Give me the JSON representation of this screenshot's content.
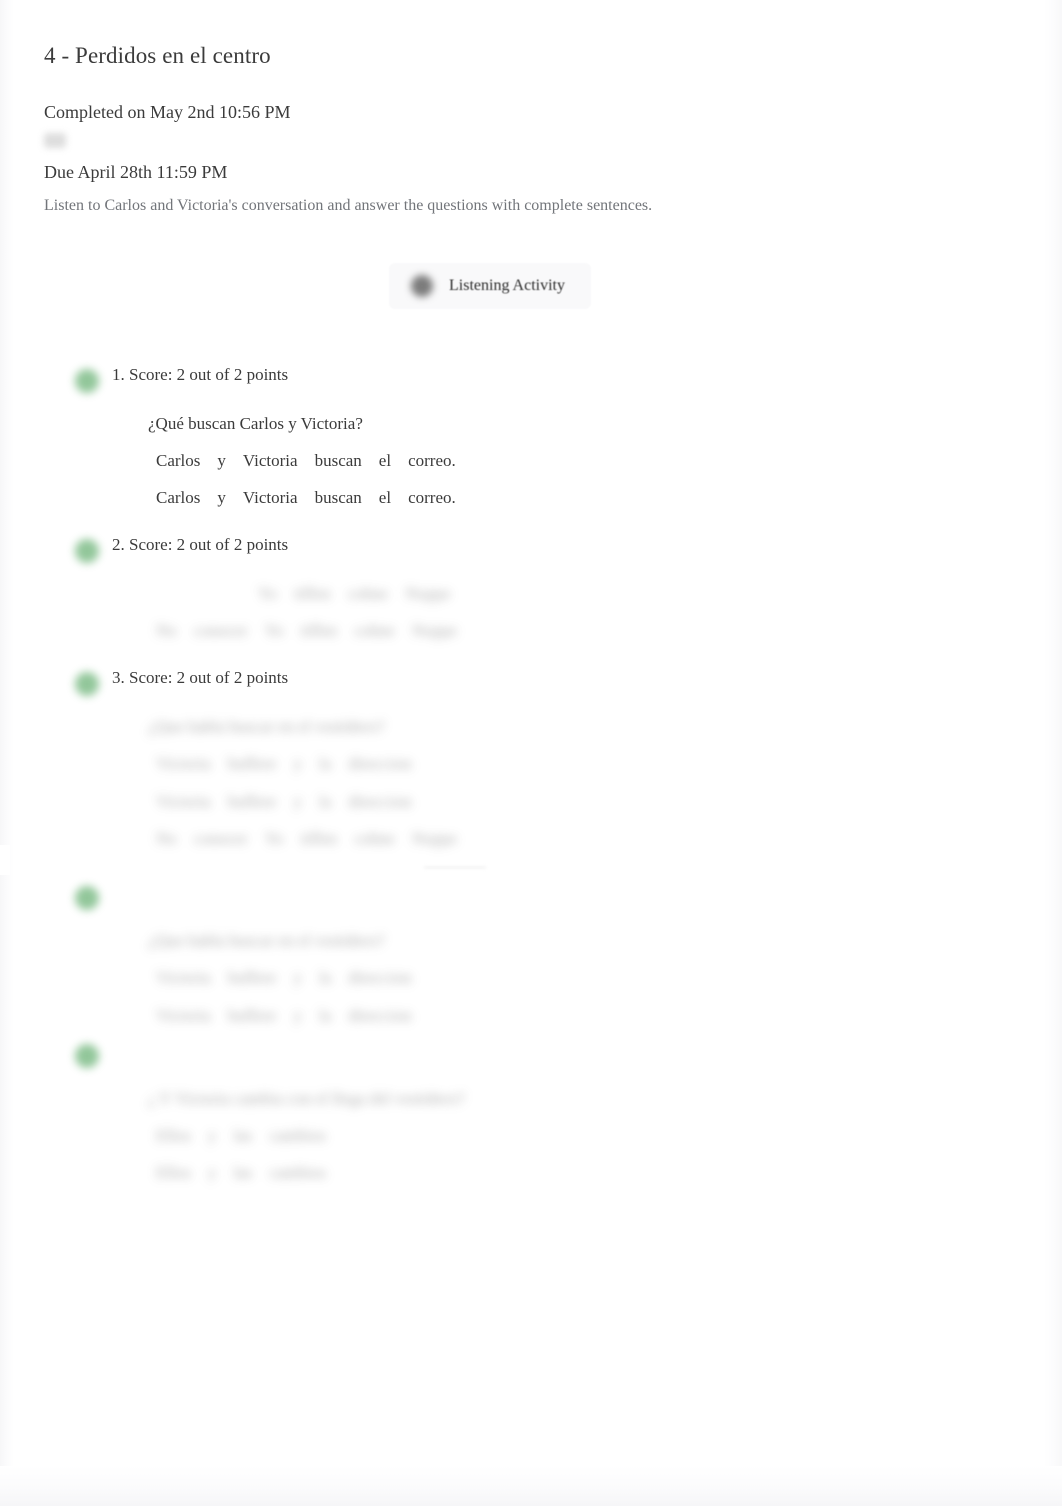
{
  "header": {
    "quiz_title": "4 - Perdidos en el centro",
    "completed_on": "Completed on May 2nd 10:56 PM",
    "due": "Due April 28th 11:59 PM",
    "instructions": "Listen to Carlos and Victoria's conversation and answer the questions with complete sentences.",
    "status_icon": "redacted-icon"
  },
  "activity": {
    "label": "Listening Activity",
    "icon": "audio-play-icon"
  },
  "colors": {
    "correct_green": "#4fa45c",
    "body_text": "#3b3b3b",
    "muted_text": "#72757a",
    "page_background": "#ffffff"
  },
  "questions": [
    {
      "id": "q1",
      "status_icon": "check-circle-icon",
      "score_label": "1. Score: 2 out of 2 points",
      "redacted": false,
      "prompt": "¿Qué buscan Carlos y Victoria?",
      "prompt_redacted": false,
      "answers": [
        {
          "tokens": [
            "Carlos",
            "y",
            "Victoria",
            "buscan",
            "el",
            "correo."
          ],
          "redacted": false,
          "indent": 1
        },
        {
          "tokens": [
            "Carlos",
            "y",
            "Victoria",
            "buscan",
            "el",
            "correo."
          ],
          "redacted": false,
          "indent": 1
        }
      ],
      "divider": false
    },
    {
      "id": "q2",
      "status_icon": "check-circle-icon",
      "score_label": "2. Score: 2 out of 2 points",
      "redacted": false,
      "prompt": "",
      "prompt_redacted": true,
      "answers": [
        {
          "tokens": [
            "Yo",
            "tiffen",
            "cohne",
            "Noppe"
          ],
          "redacted": true,
          "indent": 2
        },
        {
          "tokens": [
            "No",
            "conocer",
            "Yo",
            "tiffen",
            "cohne",
            "Noppe"
          ],
          "redacted": true,
          "indent": 1
        }
      ],
      "divider": false
    },
    {
      "id": "q3",
      "status_icon": "check-circle-icon",
      "score_label": "3. Score: 2 out of 2 points",
      "redacted": false,
      "prompt": "¿Que habla buscar en el vestidero?",
      "prompt_redacted": true,
      "answers": [
        {
          "tokens": [
            "Victoria",
            "buffere",
            "y",
            "la",
            "direccion"
          ],
          "redacted": true,
          "indent": 1
        },
        {
          "tokens": [
            "Victoria",
            "buffere",
            "y",
            "la",
            "direccion"
          ],
          "redacted": true,
          "indent": 1
        },
        {
          "tokens": [
            "No",
            "conocer",
            "Yo",
            "tiffen",
            "cohne",
            "Noppe"
          ],
          "redacted": true,
          "indent": 1
        }
      ],
      "divider": true
    },
    {
      "id": "q4",
      "status_icon": "check-circle-icon",
      "score_label": "",
      "redacted": true,
      "prompt": "¿Que habla buscar en el vestidero?",
      "prompt_redacted": true,
      "answers": [
        {
          "tokens": [
            "Victoria",
            "buffere",
            "y",
            "la",
            "direccion"
          ],
          "redacted": true,
          "indent": 1
        },
        {
          "tokens": [
            "Victoria",
            "buffere",
            "y",
            "la",
            "direccion"
          ],
          "redacted": true,
          "indent": 1
        }
      ],
      "divider": false
    },
    {
      "id": "q5",
      "status_icon": "check-circle-icon",
      "score_label": "",
      "redacted": true,
      "prompt": "¿ Y Victoria cambia con el llega del vestidero?",
      "prompt_redacted": true,
      "answers": [
        {
          "tokens": [
            "Ellos",
            "y",
            "las",
            "cambios"
          ],
          "redacted": true,
          "indent": 1
        },
        {
          "tokens": [
            "Ellos",
            "y",
            "las",
            "cambios"
          ],
          "redacted": true,
          "indent": 1
        }
      ],
      "divider": false
    }
  ]
}
